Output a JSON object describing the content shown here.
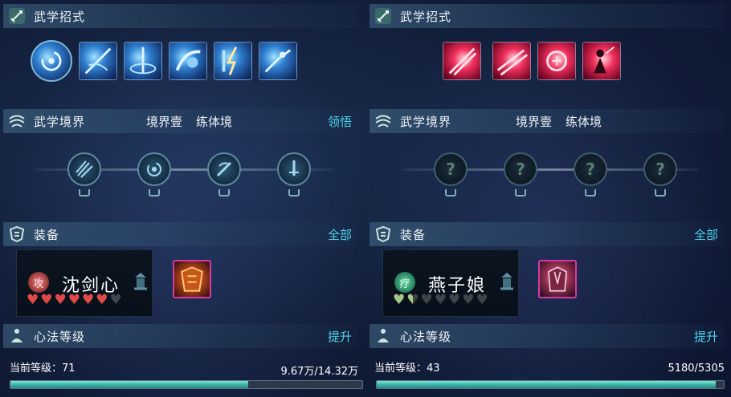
{
  "panels": [
    {
      "skills_header": {
        "title": "武学招式"
      },
      "realm_header": {
        "title": "武学境界",
        "level": "境界壹",
        "stage": "练体境",
        "action": "领悟"
      },
      "equipment_header": {
        "title": "装备",
        "action": "全部"
      },
      "character": {
        "badge": "攻",
        "name": "沈剑心",
        "hearts_filled": 6,
        "hearts_total": 7
      },
      "heart_method_header": {
        "title": "心法等级",
        "action": "提升"
      },
      "level_label": "当前等级：71",
      "progress_label": "9.67万/14.32万",
      "progress_fraction": 0.675,
      "skill_icons": [
        "swirl-skill-icon",
        "sword-slash-skill-icon",
        "vortex-skill-icon",
        "fist-strike-skill-icon",
        "lightning-skill-icon",
        "dash-strike-skill-icon"
      ],
      "realm_nodes": [
        "slash-realm-icon",
        "swirl-realm-icon",
        "blade-realm-icon",
        "sword-realm-icon"
      ]
    },
    {
      "skills_header": {
        "title": "武学招式"
      },
      "realm_header": {
        "title": "武学境界",
        "level": "境界壹",
        "stage": "练体境",
        "action": ""
      },
      "equipment_header": {
        "title": "装备",
        "action": "全部"
      },
      "character": {
        "badge": "疗",
        "name": "燕子娘",
        "hearts_filled": 1.5,
        "hearts_total": 7
      },
      "heart_method_header": {
        "title": "心法等级",
        "action": "提升"
      },
      "level_label": "当前等级：43",
      "progress_label": "5180/5305",
      "progress_fraction": 0.976,
      "skill_icons": [
        "crimson-slash-skill-icon",
        "crimson-strike-skill-icon",
        "crimson-seal-skill-icon",
        "crimson-figure-skill-icon"
      ],
      "realm_nodes": [
        "locked-realm-icon",
        "locked-realm-icon",
        "locked-realm-icon",
        "locked-realm-icon"
      ],
      "locked_glyph": "?"
    }
  ],
  "colors": {
    "accent": "#4fd2ea",
    "progress": "#3fb4a8",
    "equip_border": "#d63aa8"
  }
}
